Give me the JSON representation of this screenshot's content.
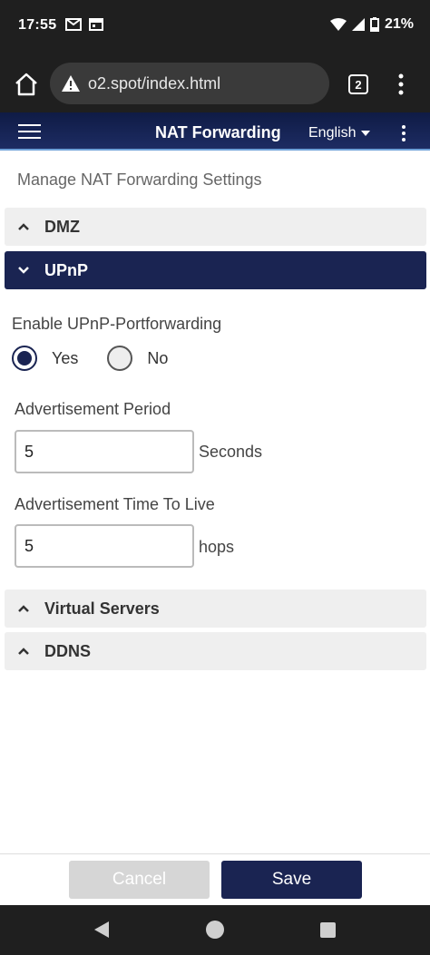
{
  "status_bar": {
    "time": "17:55",
    "battery": "21%"
  },
  "browser": {
    "url": "o2.spot/index.html",
    "tab_count": "2"
  },
  "header": {
    "title": "NAT Forwarding",
    "language": "English"
  },
  "page": {
    "subtitle": "Manage NAT Forwarding Settings"
  },
  "sections": {
    "dmz": "DMZ",
    "upnp": "UPnP",
    "virtual_servers": "Virtual Servers",
    "ddns": "DDNS"
  },
  "upnp": {
    "enable_label": "Enable UPnP-Portforwarding",
    "yes_label": "Yes",
    "no_label": "No",
    "selected": "Yes",
    "ad_period_label": "Advertisement Period",
    "ad_period_value": "5",
    "ad_period_unit": "Seconds",
    "ttl_label": "Advertisement Time To Live",
    "ttl_value": "5",
    "ttl_unit": "hops"
  },
  "actions": {
    "cancel": "Cancel",
    "save": "Save"
  },
  "colors": {
    "accent": "#1a2452",
    "header_border": "#6ea1d8"
  }
}
